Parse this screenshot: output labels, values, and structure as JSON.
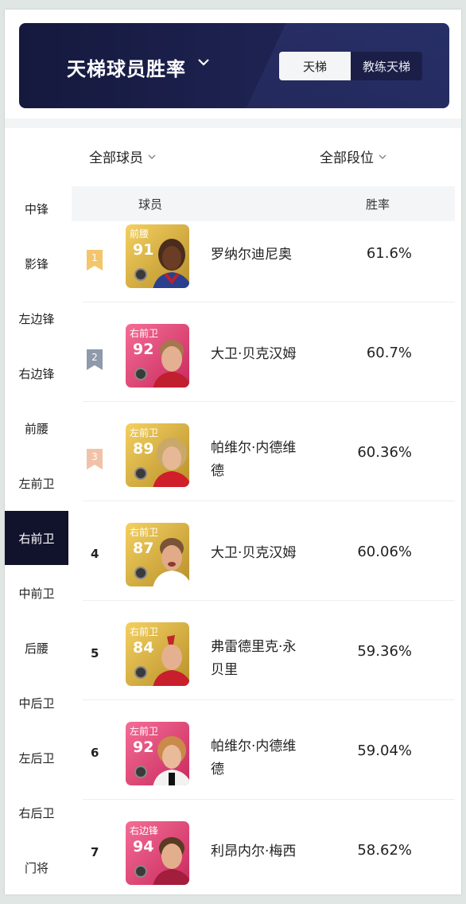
{
  "header": {
    "title": "天梯球员胜率",
    "tabs": [
      {
        "label": "天梯",
        "active": true
      },
      {
        "label": "教练天梯",
        "active": false
      }
    ]
  },
  "filters": {
    "players": "全部球员",
    "tiers": "全部段位"
  },
  "sidebar": {
    "items": [
      {
        "label": "中锋",
        "active": false
      },
      {
        "label": "影锋",
        "active": false
      },
      {
        "label": "左边锋",
        "active": false
      },
      {
        "label": "右边锋",
        "active": false
      },
      {
        "label": "前腰",
        "active": false
      },
      {
        "label": "左前卫",
        "active": false
      },
      {
        "label": "右前卫",
        "active": true
      },
      {
        "label": "中前卫",
        "active": false
      },
      {
        "label": "后腰",
        "active": false
      },
      {
        "label": "中后卫",
        "active": false
      },
      {
        "label": "左后卫",
        "active": false
      },
      {
        "label": "右后卫",
        "active": false
      },
      {
        "label": "门将",
        "active": false
      }
    ]
  },
  "table": {
    "headers": {
      "player": "球员",
      "winrate": "胜率"
    },
    "rows": [
      {
        "rank": "1",
        "position": "前腰",
        "rating": "91",
        "name_line1": "罗纳尔迪尼奥",
        "name_line2": "",
        "winrate": "61.6%",
        "card": "gold"
      },
      {
        "rank": "2",
        "position": "右前卫",
        "rating": "92",
        "name_line1": "大卫·贝克汉姆",
        "name_line2": "",
        "winrate": "60.7%",
        "card": "pink"
      },
      {
        "rank": "3",
        "position": "左前卫",
        "rating": "89",
        "name_line1": "帕维尔·内德维",
        "name_line2": "德",
        "winrate": "60.36%",
        "card": "gold"
      },
      {
        "rank": "4",
        "position": "右前卫",
        "rating": "87",
        "name_line1": "大卫·贝克汉姆",
        "name_line2": "",
        "winrate": "60.06%",
        "card": "gold"
      },
      {
        "rank": "5",
        "position": "右前卫",
        "rating": "84",
        "name_line1": "弗雷德里克·永",
        "name_line2": "贝里",
        "winrate": "59.36%",
        "card": "gold"
      },
      {
        "rank": "6",
        "position": "左前卫",
        "rating": "92",
        "name_line1": "帕维尔·内德维",
        "name_line2": "德",
        "winrate": "59.04%",
        "card": "pink"
      },
      {
        "rank": "7",
        "position": "右边锋",
        "rating": "94",
        "name_line1": "利昂内尔·梅西",
        "name_line2": "",
        "winrate": "58.62%",
        "card": "pink"
      }
    ]
  },
  "colors": {
    "header_bg": "#1b1f4a",
    "sidebar_active": "#11132c",
    "card_gold": "#c9a531",
    "card_pink": "#e8457a",
    "rank1": "#f3c66b",
    "rank2": "#8f99ac",
    "rank3": "#f2c2a8"
  }
}
